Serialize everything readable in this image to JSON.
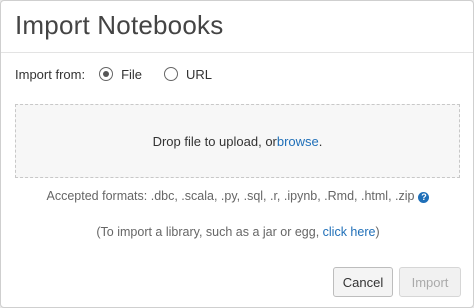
{
  "dialog": {
    "title": "Import Notebooks",
    "import_from_label": "Import from:",
    "options": [
      {
        "label": "File",
        "checked": true
      },
      {
        "label": "URL",
        "checked": false
      }
    ],
    "dropzone": {
      "text": "Drop file to upload, or ",
      "link": "browse",
      "suffix": "."
    },
    "formats_text": "Accepted formats: .dbc, .scala, .py, .sql, .r, .ipynb, .Rmd, .html, .zip",
    "help_icon": "question-circle-icon",
    "library_prefix": "(To import a library, such as a jar or egg, ",
    "library_link": "click here",
    "library_suffix": ")",
    "buttons": {
      "cancel": "Cancel",
      "import": "Import"
    },
    "colors": {
      "link": "#1f6fb8",
      "disabled_text": "#aaaaaa"
    }
  }
}
